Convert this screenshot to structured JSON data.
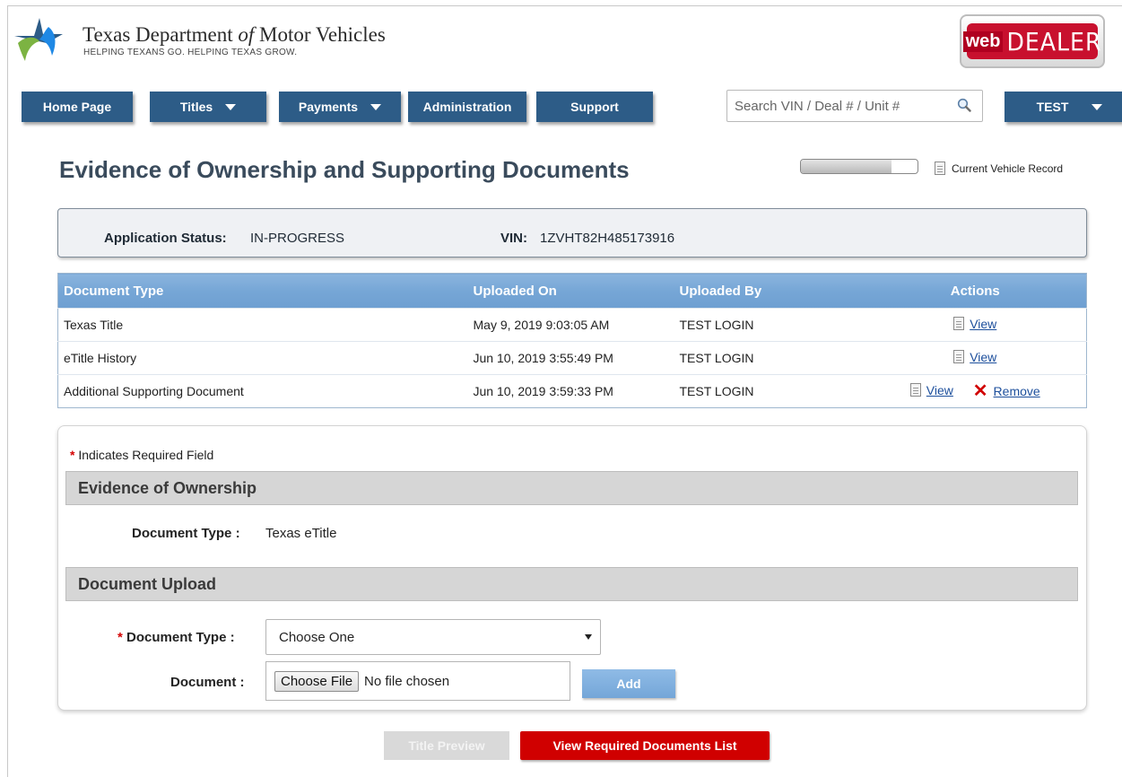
{
  "brand": {
    "title_pre": "Texas Department ",
    "title_of": "of",
    "title_post": " Motor Vehicles",
    "subtitle": "HELPING TEXANS GO. HELPING TEXAS GROW.",
    "product_web": "web",
    "product_dealer": "DEALER"
  },
  "nav": {
    "home": "Home Page",
    "titles": "Titles",
    "payments": "Payments",
    "administration": "Administration",
    "support": "Support",
    "search_placeholder": "Search VIN / Deal # / Unit #",
    "user": "TEST"
  },
  "page": {
    "title": "Evidence of Ownership and Supporting Documents",
    "progress_fraction": 0.78,
    "current_vehicle_record": "Current Vehicle Record"
  },
  "status": {
    "app_status_label": "Application Status:",
    "app_status_value": "IN-PROGRESS",
    "vin_label": "VIN:",
    "vin_value": "1ZVHT82H485173916"
  },
  "table": {
    "headers": [
      "Document Type",
      "Uploaded On",
      "Uploaded By",
      "Actions"
    ],
    "rows": [
      {
        "doc_type": "Texas Title",
        "uploaded_on": "May 9, 2019 9:03:05 AM",
        "uploaded_by": "TEST LOGIN",
        "view": "View"
      },
      {
        "doc_type": "eTitle History",
        "uploaded_on": "Jun 10, 2019 3:55:49 PM",
        "uploaded_by": "TEST LOGIN",
        "view": "View"
      },
      {
        "doc_type": "Additional Supporting Document",
        "uploaded_on": "Jun 10, 2019 3:59:33 PM",
        "uploaded_by": "TEST LOGIN",
        "view": "View",
        "remove": "Remove"
      }
    ]
  },
  "form": {
    "required_star": "*",
    "required_note": "Indicates Required Field",
    "section_ownership": "Evidence of Ownership",
    "doc_type_label": "Document Type :",
    "doc_type_value": "Texas eTitle",
    "section_upload": "Document Upload",
    "upload_doc_type_label": "Document Type :",
    "upload_doc_type_selected": "Choose One",
    "document_label": "Document :",
    "choose_file": "Choose File",
    "no_file": "No file chosen",
    "add": "Add"
  },
  "buttons": {
    "title_preview": "Title Preview",
    "view_required": "View Required Documents List"
  },
  "colors": {
    "nav_blue": "#2d5c87",
    "table_header_blue": "#76a6d6",
    "accent_red": "#d00000"
  }
}
